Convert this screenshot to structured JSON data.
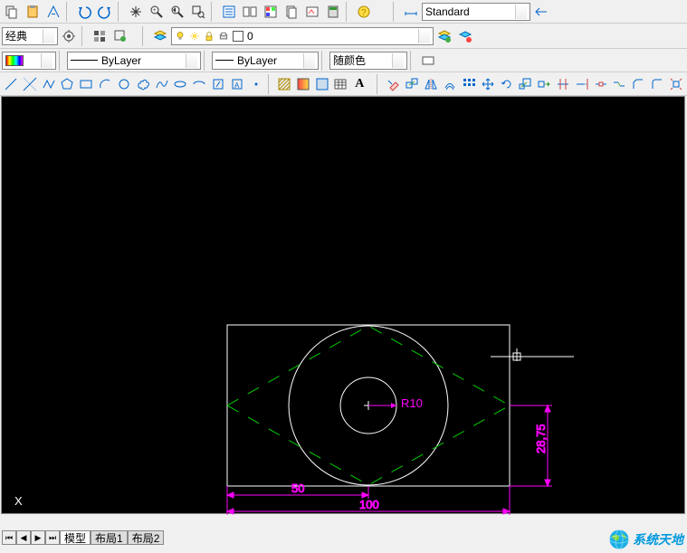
{
  "toolbars": {
    "top1": {
      "style_dropdown": "Standard"
    },
    "top2": {
      "workspace": "经典",
      "layer": "0"
    },
    "top3": {
      "linetype_dd": "ByLayer",
      "lineweight_dd": "ByLayer",
      "color_dd": "随颜色"
    }
  },
  "tabs": {
    "model": "模型",
    "layout1": "布局1",
    "layout2": "布局2"
  },
  "drawing": {
    "ucs_label": "X",
    "radius_label": "R10",
    "dim_50": "50",
    "dim_100": "100",
    "dim_h": "28,75"
  },
  "chart_data": {
    "type": "diagram",
    "entities": [
      {
        "kind": "rectangle",
        "width": 100,
        "height": 57.5,
        "color": "white"
      },
      {
        "kind": "circle",
        "radius": 10,
        "center": "rect-center",
        "label": "R10",
        "color": "white"
      },
      {
        "kind": "circle",
        "radius": 28.75,
        "center": "rect-center",
        "color": "white"
      },
      {
        "kind": "rhombus",
        "construction": true,
        "color": "green",
        "dashed": true
      },
      {
        "kind": "dimension",
        "value": 50,
        "orientation": "horizontal",
        "color": "magenta"
      },
      {
        "kind": "dimension",
        "value": 100,
        "orientation": "horizontal",
        "color": "magenta"
      },
      {
        "kind": "dimension",
        "value": 28.75,
        "orientation": "vertical",
        "color": "magenta"
      }
    ]
  },
  "watermark": "系统天地"
}
